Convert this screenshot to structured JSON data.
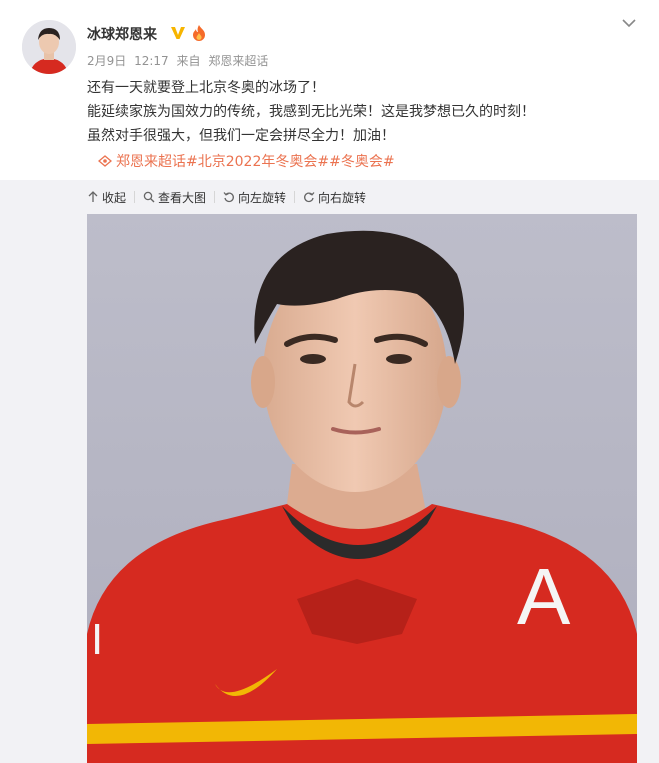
{
  "user": {
    "name": "冰球郑恩来",
    "verified_badge": "V",
    "accent_color": "#eb7350",
    "verified_color": "#f7b500"
  },
  "meta": {
    "date": "2月9日",
    "time": "12:17",
    "source_prefix": "来自",
    "source": "郑恩来超话"
  },
  "post": {
    "lines": [
      "还有一天就要登上北京冬奥的冰场了！",
      "能延续家族为国效力的传统，我感到无比光荣！这是我梦想已久的时刻！",
      "虽然对手很强大，但我们一定会拼尽全力！加油！"
    ],
    "topics": "郑恩来超话#北京2022年冬奥会##冬奥会#"
  },
  "toolbar": {
    "collapse": "收起",
    "view_large": "查看大图",
    "rotate_left": "向左旋转",
    "rotate_right": "向右旋转"
  },
  "photo": {
    "jersey_letter": "A",
    "jersey_color": "#d62a20",
    "background_color": "#b7b7c5"
  }
}
